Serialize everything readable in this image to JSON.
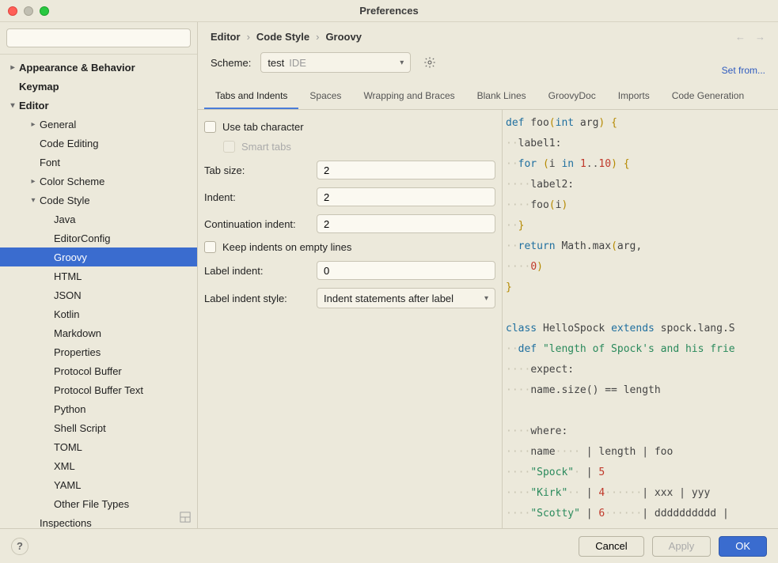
{
  "window": {
    "title": "Preferences"
  },
  "search": {
    "placeholder": ""
  },
  "sidebar": {
    "items": [
      {
        "label": "Appearance & Behavior",
        "bold": true,
        "arrow": "right",
        "indent": 0
      },
      {
        "label": "Keymap",
        "bold": true,
        "arrow": "",
        "indent": 0
      },
      {
        "label": "Editor",
        "bold": true,
        "arrow": "down",
        "indent": 0
      },
      {
        "label": "General",
        "arrow": "right",
        "indent": 1
      },
      {
        "label": "Code Editing",
        "arrow": "",
        "indent": 1
      },
      {
        "label": "Font",
        "arrow": "",
        "indent": 1
      },
      {
        "label": "Color Scheme",
        "arrow": "right",
        "indent": 1
      },
      {
        "label": "Code Style",
        "arrow": "down",
        "indent": 1
      },
      {
        "label": "Java",
        "arrow": "",
        "indent": 2
      },
      {
        "label": "EditorConfig",
        "arrow": "",
        "indent": 2
      },
      {
        "label": "Groovy",
        "arrow": "",
        "indent": 2,
        "selected": true
      },
      {
        "label": "HTML",
        "arrow": "",
        "indent": 2
      },
      {
        "label": "JSON",
        "arrow": "",
        "indent": 2
      },
      {
        "label": "Kotlin",
        "arrow": "",
        "indent": 2
      },
      {
        "label": "Markdown",
        "arrow": "",
        "indent": 2
      },
      {
        "label": "Properties",
        "arrow": "",
        "indent": 2
      },
      {
        "label": "Protocol Buffer",
        "arrow": "",
        "indent": 2
      },
      {
        "label": "Protocol Buffer Text",
        "arrow": "",
        "indent": 2
      },
      {
        "label": "Python",
        "arrow": "",
        "indent": 2
      },
      {
        "label": "Shell Script",
        "arrow": "",
        "indent": 2
      },
      {
        "label": "TOML",
        "arrow": "",
        "indent": 2
      },
      {
        "label": "XML",
        "arrow": "",
        "indent": 2
      },
      {
        "label": "YAML",
        "arrow": "",
        "indent": 2
      },
      {
        "label": "Other File Types",
        "arrow": "",
        "indent": 2
      },
      {
        "label": "Inspections",
        "arrow": "",
        "indent": 1
      }
    ]
  },
  "breadcrumbs": [
    "Editor",
    "Code Style",
    "Groovy"
  ],
  "scheme": {
    "label": "Scheme:",
    "value": "test",
    "badge": "IDE"
  },
  "setfrom": "Set from...",
  "tabs": [
    "Tabs and Indents",
    "Spaces",
    "Wrapping and Braces",
    "Blank Lines",
    "GroovyDoc",
    "Imports",
    "Code Generation"
  ],
  "activeTab": 0,
  "form": {
    "useTab": "Use tab character",
    "smartTabs": "Smart tabs",
    "tabSize": {
      "label": "Tab size:",
      "value": "2"
    },
    "indent": {
      "label": "Indent:",
      "value": "2"
    },
    "contIndent": {
      "label": "Continuation indent:",
      "value": "2"
    },
    "keepEmpty": "Keep indents on empty lines",
    "labelIndent": {
      "label": "Label indent:",
      "value": "0"
    },
    "labelStyle": {
      "label": "Label indent style:",
      "value": "Indent statements after label"
    }
  },
  "footer": {
    "cancel": "Cancel",
    "apply": "Apply",
    "ok": "OK"
  }
}
